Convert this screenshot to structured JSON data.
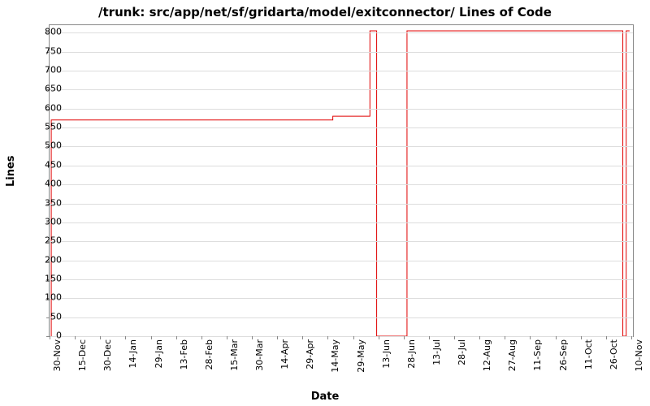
{
  "chart_data": {
    "type": "line",
    "title": "/trunk: src/app/net/sf/gridarta/model/exitconnector/ Lines of Code",
    "xlabel": "Date",
    "ylabel": "Lines",
    "ylim": [
      0,
      820
    ],
    "yticks": [
      0,
      50,
      100,
      150,
      200,
      250,
      300,
      350,
      400,
      450,
      500,
      550,
      600,
      650,
      700,
      750,
      800
    ],
    "xticks": [
      "30-Nov",
      "15-Dec",
      "30-Dec",
      "14-Jan",
      "29-Jan",
      "13-Feb",
      "28-Feb",
      "15-Mar",
      "30-Mar",
      "14-Apr",
      "29-Apr",
      "14-May",
      "29-May",
      "13-Jun",
      "28-Jun",
      "13-Jul",
      "28-Jul",
      "12-Aug",
      "27-Aug",
      "11-Sep",
      "26-Sep",
      "11-Oct",
      "26-Oct",
      "10-Nov"
    ],
    "x_range_days": 346,
    "series": [
      {
        "name": "lines-of-code",
        "color": "#e00000",
        "points": [
          {
            "day": 1,
            "value": 0
          },
          {
            "day": 1,
            "value": 570
          },
          {
            "day": 168,
            "value": 570
          },
          {
            "day": 168,
            "value": 580
          },
          {
            "day": 190,
            "value": 580
          },
          {
            "day": 190,
            "value": 805
          },
          {
            "day": 194,
            "value": 805
          },
          {
            "day": 194,
            "value": 0
          },
          {
            "day": 212,
            "value": 0
          },
          {
            "day": 212,
            "value": 805
          },
          {
            "day": 340,
            "value": 805
          },
          {
            "day": 340,
            "value": 0
          },
          {
            "day": 342,
            "value": 0
          },
          {
            "day": 342,
            "value": 805
          },
          {
            "day": 344,
            "value": 805
          }
        ]
      }
    ]
  }
}
